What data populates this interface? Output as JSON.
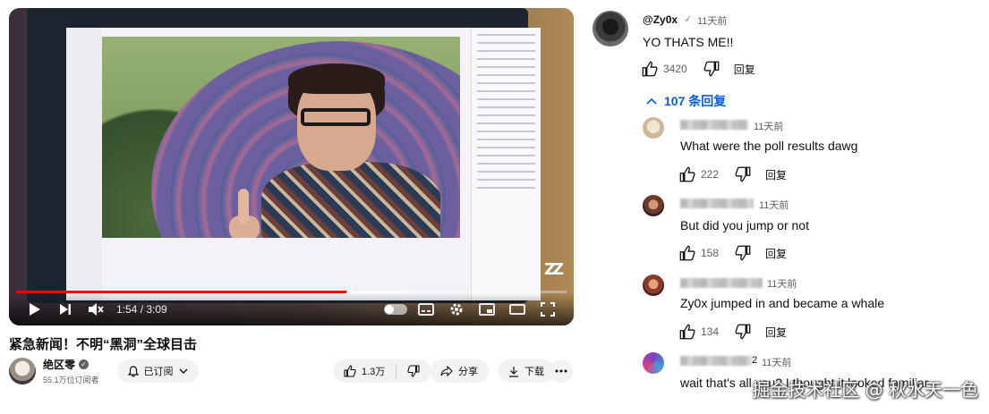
{
  "player": {
    "time_display": "1:54 / 3:09",
    "progress_played": 0.6,
    "progress_buffered": 0.71,
    "accent_color": "#ff0000",
    "stream_logo": "ZZ"
  },
  "video": {
    "title": "紧急新闻！不明“黑洞”全球目击",
    "channel_name": "绝区零",
    "subscribers": "55.1万位订阅者",
    "subscribe_label": "已订阅",
    "likes": "1.3万",
    "share_label": "分享",
    "download_label": "下载"
  },
  "comments": {
    "top": {
      "author": "@Zy0x",
      "verified_mark": "✓",
      "time": "11天前",
      "text": "YO THATS ME!!",
      "likes": "3420",
      "reply_label": "回复"
    },
    "replies_toggle": "107 条回复",
    "replies": [
      {
        "time": "11天前",
        "text": "What were the poll results dawg",
        "likes": "222",
        "reply_label": "回复"
      },
      {
        "time": "11天前",
        "text": "But did you jump or not",
        "likes": "158",
        "reply_label": "回复"
      },
      {
        "time": "11天前",
        "text": "Zy0x jumped in and became a whale",
        "likes": "134",
        "reply_label": "回复"
      },
      {
        "time": "11天前",
        "name_suffix": "2",
        "text": "wait that's all you? I thought it looked familiar"
      }
    ]
  },
  "watermark": "掘金技术社区 @ 秋水天一色"
}
